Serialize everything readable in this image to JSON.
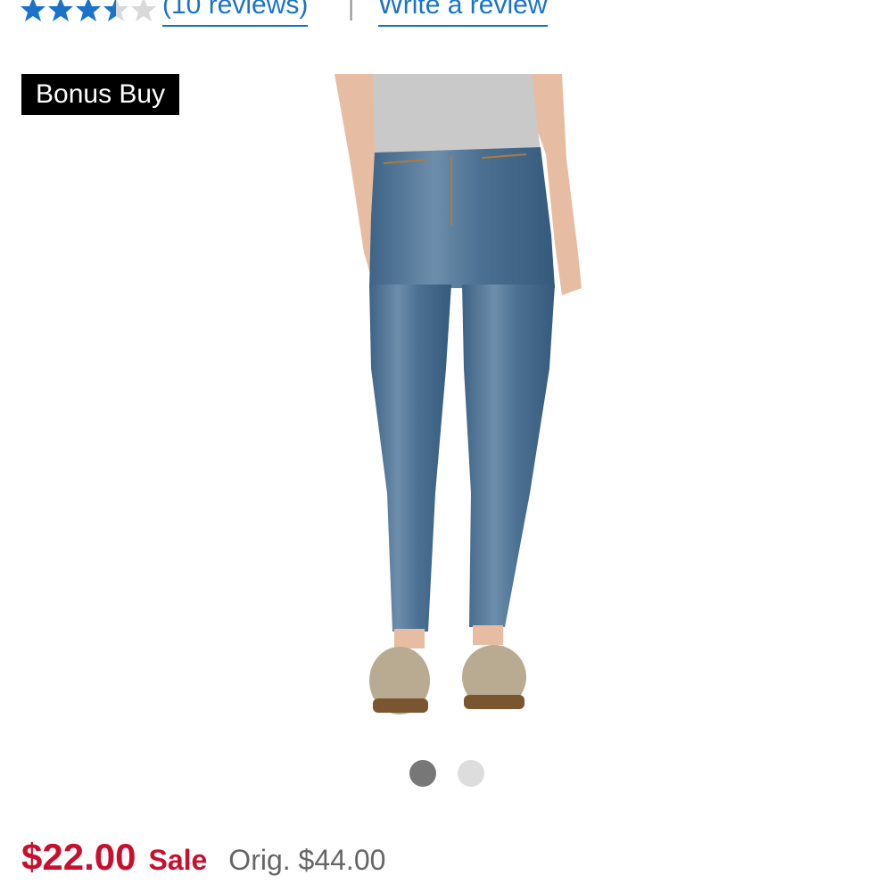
{
  "rating": {
    "value": 3.5,
    "max": 5,
    "reviews_link": "(10 reviews)",
    "divider": "|",
    "write_review_link": "Write a review"
  },
  "badge": {
    "label": "Bonus Buy"
  },
  "product_image": {
    "icon": "product-photo-skinny-jeans"
  },
  "carousel": {
    "count": 2,
    "active_index": 0
  },
  "pricing": {
    "sale_price": "$22.00",
    "sale_label": "Sale",
    "original_price": "Orig. $44.00"
  },
  "colors": {
    "link": "#1a73c9",
    "star_filled": "#1a73c9",
    "star_empty": "#d9d9d9",
    "sale": "#c8102e",
    "badge_bg": "#000000"
  }
}
